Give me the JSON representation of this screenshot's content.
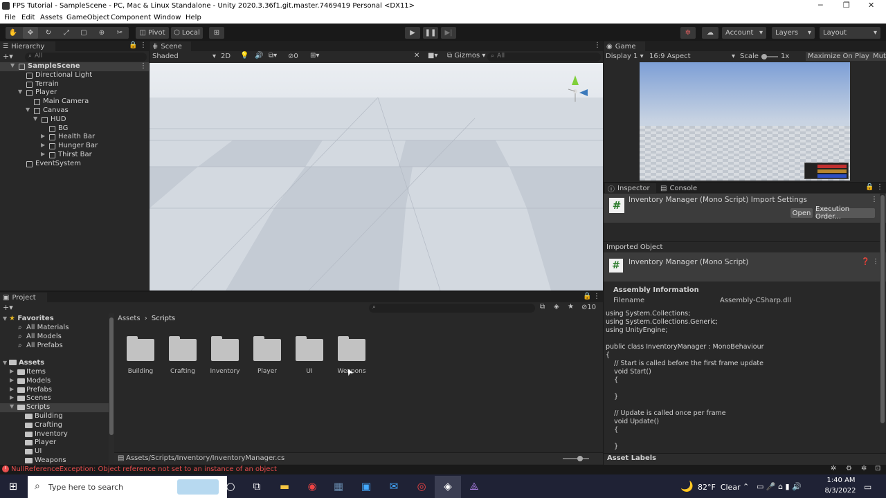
{
  "window": {
    "title": "FPS Tutorial - SampleScene - PC, Mac & Linux Standalone - Unity 2020.3.36f1.git.master.7469419 Personal <DX11>"
  },
  "menu": [
    "File",
    "Edit",
    "Assets",
    "GameObject",
    "Component",
    "Window",
    "Help"
  ],
  "toolbar": {
    "pivot": "Pivot",
    "local": "Local",
    "account": "Account",
    "layers": "Layers",
    "layout": "Layout"
  },
  "hierarchy": {
    "tab": "Hierarchy",
    "search_placeholder": "All",
    "items": [
      {
        "label": "SampleScene",
        "indent": 0,
        "kind": "scene"
      },
      {
        "label": "Directional Light",
        "indent": 1,
        "kind": "obj"
      },
      {
        "label": "Terrain",
        "indent": 1,
        "kind": "obj"
      },
      {
        "label": "Player",
        "indent": 1,
        "kind": "obj"
      },
      {
        "label": "Main Camera",
        "indent": 2,
        "kind": "obj"
      },
      {
        "label": "Canvas",
        "indent": 2,
        "kind": "obj"
      },
      {
        "label": "HUD",
        "indent": 3,
        "kind": "obj"
      },
      {
        "label": "BG",
        "indent": 4,
        "kind": "obj"
      },
      {
        "label": "Health Bar",
        "indent": 4,
        "kind": "obj"
      },
      {
        "label": "Hunger Bar",
        "indent": 4,
        "kind": "obj"
      },
      {
        "label": "Thirst Bar",
        "indent": 4,
        "kind": "obj"
      },
      {
        "label": "EventSystem",
        "indent": 1,
        "kind": "obj"
      }
    ]
  },
  "scene": {
    "tab": "Scene",
    "shading": "Shaded",
    "mode2d": "2D",
    "gizmos": "Gizmos",
    "search_placeholder": "All",
    "fx_count": "0"
  },
  "game": {
    "tab": "Game",
    "display": "Display 1",
    "aspect": "16:9 Aspect",
    "scale_label": "Scale",
    "scale_value": "1x",
    "maximize": "Maximize On Play",
    "mute": "Mute"
  },
  "inspector": {
    "tab": "Inspector",
    "console_tab": "Console",
    "header_title": "Inventory Manager (Mono Script) Import Settings",
    "open_btn": "Open",
    "exec_btn": "Execution Order...",
    "imported_object": "Imported Object",
    "script_title": "Inventory Manager (Mono Script)",
    "assembly_info": "Assembly Information",
    "filename_label": "Filename",
    "filename_value": "Assembly-CSharp.dll",
    "code": "using System.Collections;\nusing System.Collections.Generic;\nusing UnityEngine;\n\npublic class InventoryManager : MonoBehaviour\n{\n    // Start is called before the first frame update\n    void Start()\n    {\n\n    }\n\n    // Update is called once per frame\n    void Update()\n    {\n\n    }",
    "asset_labels": "Asset Labels"
  },
  "project": {
    "tab": "Project",
    "breadcrumb_root": "Assets",
    "breadcrumb_current": "Scripts",
    "hidden_count": "10",
    "favorites": {
      "label": "Favorites",
      "items": [
        "All Materials",
        "All Models",
        "All Prefabs"
      ]
    },
    "assets": {
      "label": "Assets",
      "items": [
        "Items",
        "Models",
        "Prefabs",
        "Scenes",
        "Scripts"
      ]
    },
    "scripts_children": [
      "Building",
      "Crafting",
      "Inventory",
      "Player",
      "UI",
      "Weapons"
    ],
    "folders": [
      "Building",
      "Crafting",
      "Inventory",
      "Player",
      "UI",
      "Weapons"
    ],
    "footer_path": "Assets/Scripts/Inventory/InventoryManager.cs"
  },
  "status": {
    "error": "NullReferenceException: Object reference not set to an instance of an object"
  },
  "taskbar": {
    "search_placeholder": "Type here to search",
    "weather": "82°F  Clear",
    "time": "1:40 AM",
    "date": "8/3/2022"
  },
  "colors": {
    "accent": "#3a79bb",
    "error": "#e64c4c",
    "panel": "#282828",
    "sky": "#8aaee0"
  }
}
